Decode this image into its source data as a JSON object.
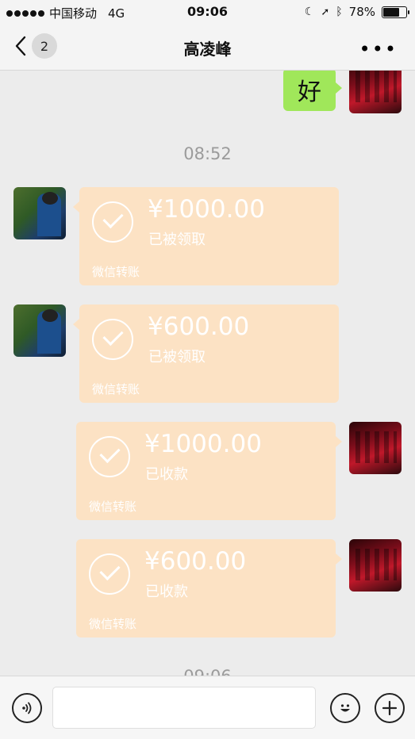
{
  "status_bar": {
    "carrier": "中国移动",
    "network": "4G",
    "time": "09:06",
    "battery": "78%",
    "battery_level": 0.78
  },
  "nav": {
    "back_badge": "2",
    "title": "高凌峰",
    "more": "•••"
  },
  "messages": {
    "text_msg": "好",
    "time_1": "08:52",
    "time_2": "09:06",
    "transfers": [
      {
        "amount": "¥1000.00",
        "status": "已被领取",
        "label": "微信转账"
      },
      {
        "amount": "¥600.00",
        "status": "已被领取",
        "label": "微信转账"
      },
      {
        "amount": "¥1000.00",
        "status": "已收款",
        "label": "微信转账"
      },
      {
        "amount": "¥600.00",
        "status": "已收款",
        "label": "微信转账"
      }
    ]
  },
  "input_bar": {
    "placeholder": ""
  }
}
